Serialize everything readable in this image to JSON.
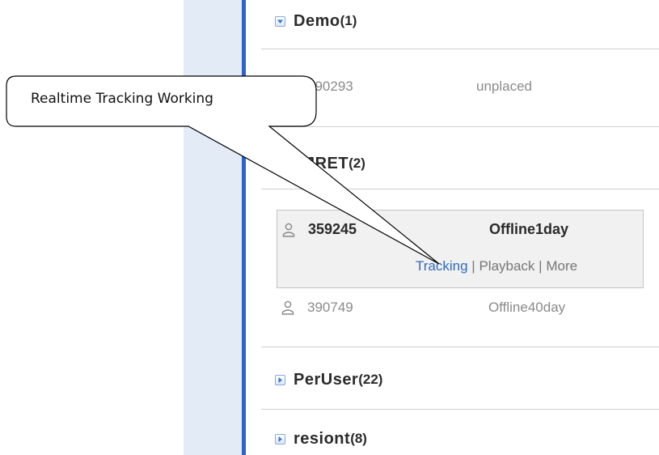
{
  "groups": [
    {
      "name": "Demo",
      "count": "(1)",
      "expanded": true
    },
    {
      "name": "NJRET",
      "count": "(2)",
      "expanded": true
    },
    {
      "name": "PerUser",
      "count": "(22)",
      "expanded": false
    },
    {
      "name": "resiont",
      "count": "(8)",
      "expanded": false
    }
  ],
  "demo_device": {
    "id": "390293",
    "status": "unplaced"
  },
  "njret_devices": [
    {
      "id": "359245",
      "status": "Offline1day",
      "selected": true
    },
    {
      "id": "390749",
      "status": "Offline40day",
      "selected": false
    }
  ],
  "actions": {
    "tracking": "Tracking",
    "separator": "|",
    "playback": "Playback",
    "more": "More"
  },
  "callout": {
    "text": "Realtime Tracking Working"
  },
  "colors": {
    "accent_bar": "#2f62c9",
    "panel": "#e3ebf7",
    "link": "#2e6cc0"
  },
  "icons": {
    "expanded": "collapse-icon",
    "collapsed": "expand-icon",
    "device": "person-icon"
  }
}
